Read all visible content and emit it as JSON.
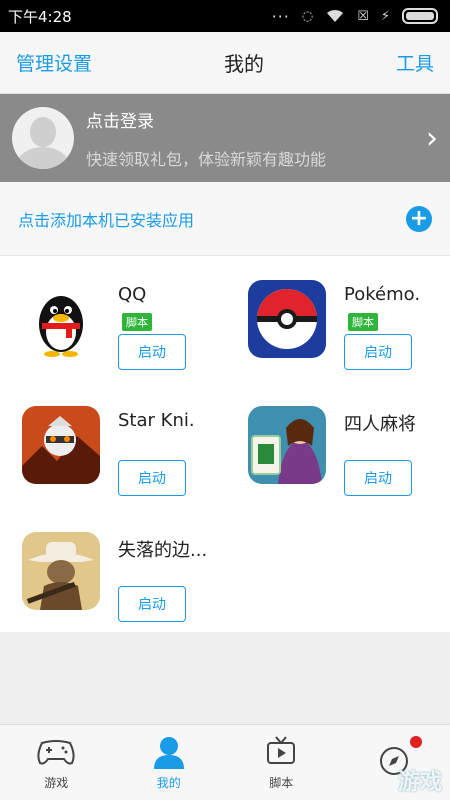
{
  "status_bar": {
    "time": "下午4:28",
    "dots": "···"
  },
  "nav": {
    "left": "管理设置",
    "title": "我的",
    "right": "工具"
  },
  "login": {
    "title": "点击登录",
    "subtitle": "快速领取礼包，体验新颖有趣功能",
    "chevron": "›"
  },
  "add_apps": {
    "label": "点击添加本机已安装应用",
    "plus": "+"
  },
  "apps": [
    {
      "name": "QQ",
      "tag": "脚本",
      "button": "启动",
      "icon": "qq-penguin-icon"
    },
    {
      "name": "Pokémo.",
      "tag": "脚本",
      "button": "启动",
      "icon": "pokeball-icon"
    },
    {
      "name": "Star Kni.",
      "tag": "",
      "button": "启动",
      "icon": "star-knight-icon"
    },
    {
      "name": "四人麻将",
      "tag": "",
      "button": "启动",
      "icon": "mahjong-icon"
    },
    {
      "name": "失落的边...",
      "tag": "",
      "button": "启动",
      "icon": "cowboy-icon"
    }
  ],
  "tabs": [
    {
      "label": "游戏",
      "icon": "gamepad-icon"
    },
    {
      "label": "我的",
      "icon": "user-icon",
      "active": true
    },
    {
      "label": "脚本",
      "icon": "tv-script-icon"
    },
    {
      "label": "",
      "icon": "compass-icon"
    }
  ],
  "watermark": "游戏"
}
